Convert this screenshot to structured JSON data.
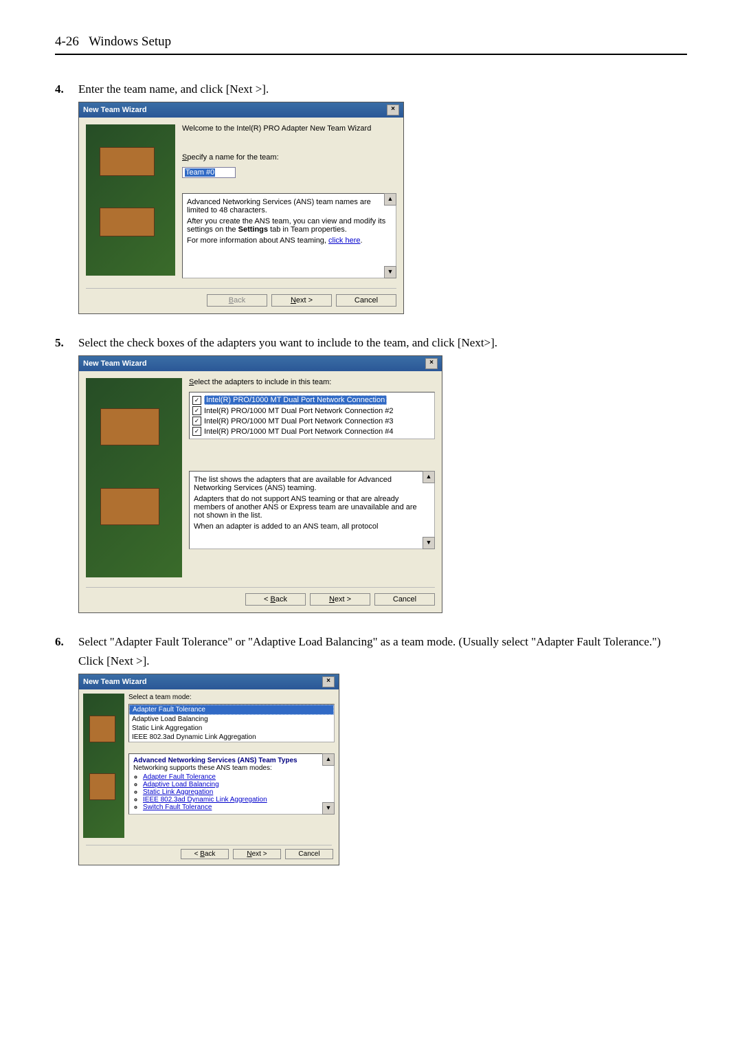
{
  "header": {
    "page": "4-26",
    "title": "Windows Setup"
  },
  "step4": {
    "num": "4.",
    "text": "Enter the team name, and click [Next >].",
    "dlg_title": "New Team Wizard",
    "welcome": "Welcome to the Intel(R) PRO Adapter New Team Wizard",
    "label": "Specify a name for the team:",
    "input_value": "Team #0",
    "info1": "Advanced Networking Services (ANS) team names are limited to 48 characters.",
    "info2_a": "After you create the ANS team, you can view and modify its settings on the ",
    "info2_b": "Settings",
    "info2_c": " tab in Team properties.",
    "info3_a": "For more information about ANS teaming, ",
    "info3_link": "click here",
    "info3_b": ".",
    "btn_back": "< Back",
    "btn_next": "Next >",
    "btn_cancel": "Cancel"
  },
  "step5": {
    "num": "5.",
    "text": "Select the check boxes of the adapters you want to include to the team, and click [Next>].",
    "dlg_title": "New Team Wizard",
    "label": "Select the adapters to include in this team:",
    "items": [
      "Intel(R) PRO/1000 MT Dual Port Network Connection",
      "Intel(R) PRO/1000 MT Dual Port Network Connection #2",
      "Intel(R) PRO/1000 MT Dual Port Network Connection #3",
      "Intel(R) PRO/1000 MT Dual Port Network Connection #4"
    ],
    "info1": "The list shows the adapters that are available for Advanced Networking Services (ANS) teaming.",
    "info2": "Adapters that do not support ANS teaming or that are already members of another ANS or Express team are unavailable and are not shown in the list.",
    "info3": "When an adapter is added to an ANS team, all protocol",
    "btn_back": "< Back",
    "btn_next": "Next >",
    "btn_cancel": "Cancel"
  },
  "step6": {
    "num": "6.",
    "text1": "Select \"Adapter Fault Tolerance\" or \"Adaptive Load Balancing\" as a team mode. (Usually select \"Adapter Fault Tolerance.\")",
    "text2": "Click [Next >].",
    "dlg_title": "New Team Wizard",
    "label": "Select a team mode:",
    "modes": [
      "Adapter Fault Tolerance",
      "Adaptive Load Balancing",
      "Static Link Aggregation",
      "IEEE 802.3ad Dynamic Link Aggregation"
    ],
    "help_hdr": "Advanced Networking Services (ANS) Team Types",
    "help_intro": "Networking supports these ANS team modes:",
    "help_items": [
      "Adapter Fault Tolerance",
      "Adaptive Load Balancing",
      "Static Link Aggregation",
      "IEEE 802.3ad Dynamic Link Aggregation",
      "Switch Fault Tolerance"
    ],
    "btn_back": "< Back",
    "btn_next": "Next >",
    "btn_cancel": "Cancel"
  }
}
